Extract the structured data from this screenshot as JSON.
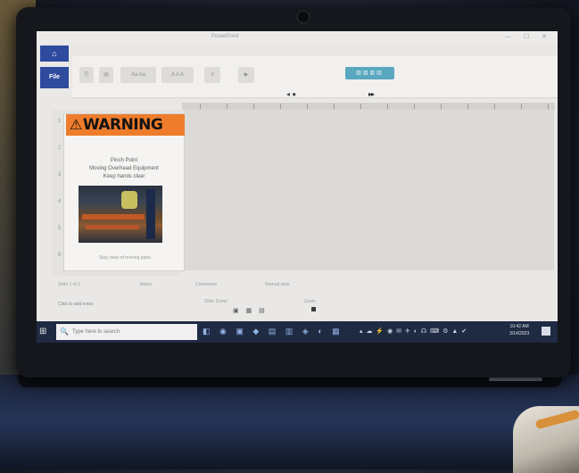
{
  "app": {
    "title": "PowerPoint",
    "file_label": "File",
    "home_label": "⌂",
    "window_controls": "— ☐ ✕"
  },
  "ribbon": {
    "buttons": [
      "⎘",
      "▤",
      "Aa Aa",
      "A A A",
      "≡",
      "▶"
    ],
    "accent_label": "▥▥▥▥"
  },
  "playback": {
    "prev": "◂ ●",
    "next": "▸▸"
  },
  "slide": {
    "warning_icon": "⚠",
    "warning_text": "WARNING",
    "lines": [
      "Pinch Point",
      "Moving Overhead Equipment",
      "Keep hands clear"
    ],
    "caption": "Stay clear of moving parts"
  },
  "slide_numbers": [
    "1",
    "2",
    "3",
    "4",
    "5",
    "6"
  ],
  "status": {
    "notes": "Click to add notes",
    "tabs": [
      "Slide 1 of 1",
      "Notes",
      "Comments",
      "Normal view"
    ],
    "view_label": "Slide Sorter",
    "zoom": "Zoom"
  },
  "taskbar": {
    "start_icon": "⊞",
    "search_placeholder": "Type here to search",
    "search_icon": "🔍",
    "pinned_icons": "◧ ◉ ▣ ◆ ▤ ▥ ◈ ◐ ▦",
    "tray_icons": "▴ ☁ ⚡ ◉ ✉ ✈ ◐ ☊ ⌨ ⚙ ▲ ✔",
    "clock_time": "10:42 AM",
    "clock_date": "3/14/2023"
  },
  "colors": {
    "warning_orange": "#ee7c2b",
    "accent_blue": "#2e4b9e",
    "taskbar": "#1f2a43"
  }
}
